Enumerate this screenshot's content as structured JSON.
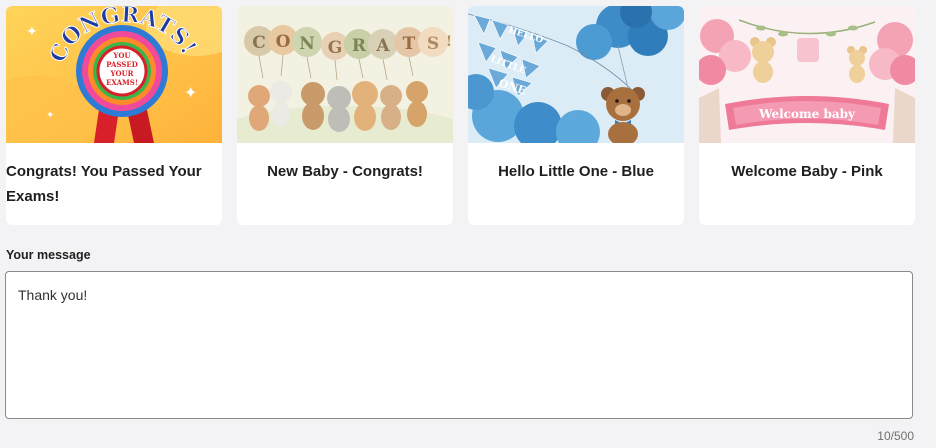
{
  "cards": [
    {
      "title": "Congrats! You Passed Your Exams!",
      "art_icon": "congrats-exams-rosette-illustration",
      "art_text": {
        "banner": "CONGRATS!",
        "rosette": [
          "YOU",
          "PASSED",
          "YOUR",
          "EXAMS!"
        ]
      }
    },
    {
      "title": "New Baby - Congrats!",
      "art_icon": "baby-animals-balloons-illustration",
      "art_text": {
        "letters": [
          "C",
          "O",
          "N",
          "G",
          "R",
          "A",
          "T",
          "S",
          "!"
        ]
      }
    },
    {
      "title": "Hello Little One - Blue",
      "art_icon": "teddy-bear-blue-balloons-illustration",
      "art_text": {
        "bunting": [
          "HELLO",
          "LITTLE",
          "ONE"
        ]
      }
    },
    {
      "title": "Welcome Baby - Pink",
      "art_icon": "teddy-bears-pink-balloons-illustration",
      "art_text": {
        "banner": "Welcome baby"
      }
    }
  ],
  "message": {
    "label": "Your message",
    "value": "Thank you!",
    "counter": "10/500"
  },
  "colors": {
    "page_bg": "#f3f3f5",
    "card_bg": "#ffffff",
    "border": "#8a8a8a"
  }
}
